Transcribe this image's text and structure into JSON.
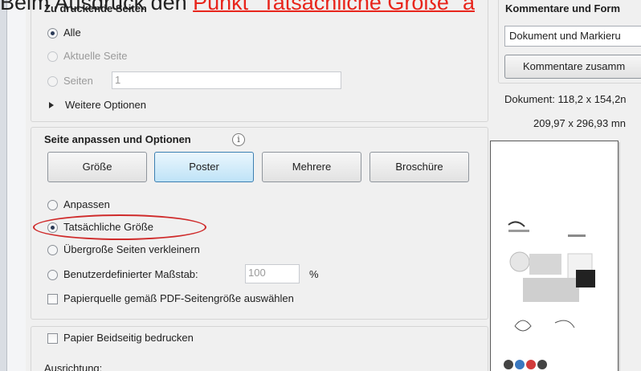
{
  "caption": {
    "prefix": "Beim Ausdruck den ",
    "highlight": "Punkt \"Tatsächliche Größe\" a"
  },
  "pages_group": {
    "header": "Zu druckende Seiten",
    "options": [
      {
        "label": "Alle",
        "checked": true,
        "disabled": false
      },
      {
        "label": "Aktuelle Seite",
        "checked": false,
        "disabled": true
      },
      {
        "label": "Seiten",
        "checked": false,
        "disabled": true
      }
    ],
    "pages_value": "1",
    "more_options": "Weitere Optionen"
  },
  "fit_group": {
    "header": "Seite anpassen und Optionen",
    "info_glyph": "i",
    "tabs": [
      {
        "label": "Größe",
        "active": false
      },
      {
        "label": "Poster",
        "active": true
      },
      {
        "label": "Mehrere",
        "active": false
      },
      {
        "label": "Broschüre",
        "active": false
      }
    ],
    "options": [
      {
        "label": "Anpassen",
        "checked": false
      },
      {
        "label": "Tatsächliche Größe",
        "checked": true
      },
      {
        "label": "Übergroße Seiten verkleinern",
        "checked": false
      },
      {
        "label": "Benutzerdefinierter Maßstab:",
        "checked": false
      }
    ],
    "scale_value": "100",
    "scale_unit": "%",
    "paper_source": "Papierquelle gemäß PDF-Seitengröße auswählen"
  },
  "duplex_group": {
    "duplex_label": "Papier Beidseitig bedrucken",
    "orientation_label": "Ausrichtung:"
  },
  "comments_group": {
    "header": "Kommentare und Form",
    "select_value": "Dokument und Markieru",
    "summary_button": "Kommentare zusamm"
  },
  "document_info": {
    "doc_size": "Dokument: 118,2 x 154,2n",
    "page_size": "209,97 x 296,93 mn"
  },
  "colors": {
    "highlight": "#e8251c",
    "ellipse": "#cf2b2b",
    "active_button": "#bfe3f7"
  }
}
